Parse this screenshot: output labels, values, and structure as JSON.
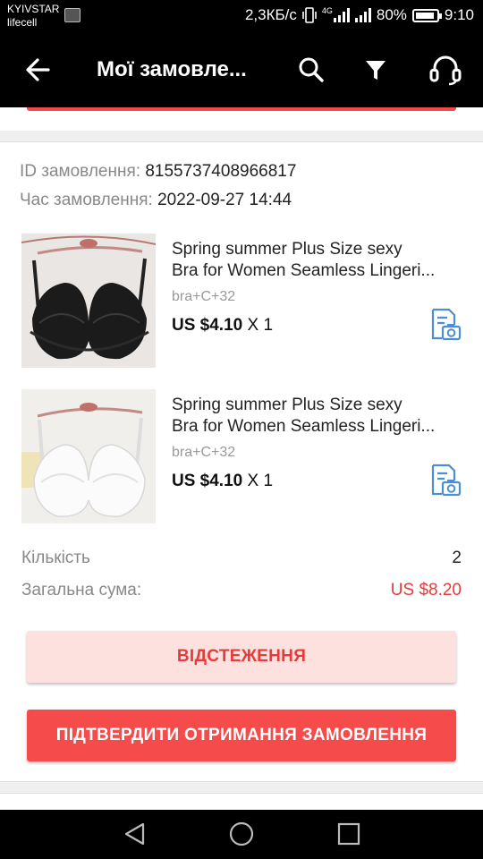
{
  "status_bar": {
    "carrier1": "KYIVSTAR",
    "carrier2": "lifecell",
    "speed": "2,3КБ/с",
    "network": "4G",
    "battery": "80%",
    "time": "9:10"
  },
  "app_bar": {
    "title": "Мої замовле...",
    "icons": [
      "back-arrow-icon",
      "search-icon",
      "filter-icon",
      "headset-icon"
    ]
  },
  "order": {
    "id_label": "ID замовлення:",
    "id_value": "8155737408966817",
    "time_label": "Час замовлення:",
    "time_value": "2022-09-27 14:44",
    "items": [
      {
        "title_line1": "Spring summer Plus Size sexy",
        "title_line2": "Bra for Women Seamless Lingeri...",
        "variant": "bra+C+32",
        "price": "US $4.10",
        "qty": "X 1",
        "color": "black"
      },
      {
        "title_line1": "Spring summer Plus Size sexy",
        "title_line2": "Bra for Women Seamless Lingeri...",
        "variant": "bra+C+32",
        "price": "US $4.10",
        "qty": "X 1",
        "color": "white"
      }
    ],
    "quantity_label": "Кількість",
    "quantity_value": "2",
    "total_label": "Загальна сума:",
    "total_value": "US $8.20",
    "track_button": "ВІДСТЕЖЕННЯ",
    "confirm_button": "ПІДТВЕРДИТИ ОТРИМАННЯ ЗАМОВЛЕННЯ"
  },
  "colors": {
    "accent": "#f64b4b",
    "accent_light": "#fde1de",
    "price_red": "#e83a3a",
    "icon_blue": "#4a8fd6"
  }
}
